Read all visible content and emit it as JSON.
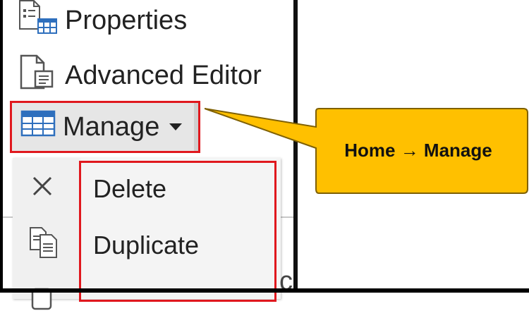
{
  "ribbon": {
    "properties_label": "Properties",
    "advanced_editor_label": "Advanced Editor",
    "manage_label": "Manage"
  },
  "manage_menu": {
    "items": [
      {
        "label": "Delete",
        "icon": "x-icon"
      },
      {
        "label": "Duplicate",
        "icon": "duplicate-icon"
      }
    ],
    "partial_item_icon": "reference-icon"
  },
  "callout": {
    "text": "Home → Manage",
    "fill": "#ffc000",
    "border": "#7f6000"
  },
  "colors": {
    "highlight": "#e0181e",
    "manage_hover": "#e6e6e6",
    "table_icon_blue": "#2e6fbd"
  }
}
